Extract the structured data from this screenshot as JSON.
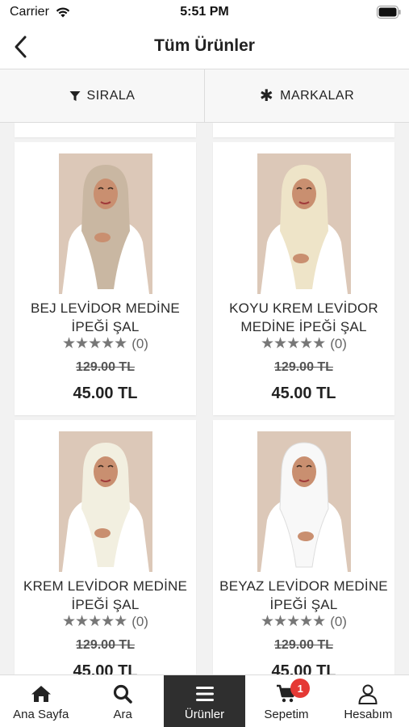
{
  "status": {
    "carrier": "Carrier",
    "time": "5:51 PM"
  },
  "nav": {
    "title": "Tüm Ürünler"
  },
  "filters": {
    "sort_label": "SIRALA",
    "brands_label": "MARKALAR"
  },
  "products": [
    {
      "name": "BEJ LEVİDOR MEDİNE İPEĞİ ŞAL",
      "reviews": "(0)",
      "old_price": "129.00 TL",
      "price": "45.00 TL",
      "scarf_color": "#c9b7a2"
    },
    {
      "name": "KOYU KREM LEVİDOR MEDİNE İPEĞİ ŞAL",
      "reviews": "(0)",
      "old_price": "129.00 TL",
      "price": "45.00 TL",
      "scarf_color": "#eee4c8"
    },
    {
      "name": "KREM LEVİDOR MEDİNE İPEĞİ ŞAL",
      "reviews": "(0)",
      "old_price": "129.00 TL",
      "price": "45.00 TL",
      "scarf_color": "#f2efe0"
    },
    {
      "name": "BEYAZ LEVİDOR MEDİNE İPEĞİ ŞAL",
      "reviews": "(0)",
      "old_price": "129.00 TL",
      "price": "45.00 TL",
      "scarf_color": "#f8f8f8"
    }
  ],
  "tabs": [
    {
      "label": "Ana Sayfa",
      "icon": "home-icon"
    },
    {
      "label": "Ara",
      "icon": "search-icon"
    },
    {
      "label": "Ürünler",
      "icon": "menu-icon"
    },
    {
      "label": "Sepetim",
      "icon": "cart-icon",
      "badge": "1"
    },
    {
      "label": "Hesabım",
      "icon": "user-icon"
    }
  ],
  "colors": {
    "active_tab": "#2f2f2f",
    "badge": "#e53935",
    "image_background": "#dcc8b8"
  }
}
